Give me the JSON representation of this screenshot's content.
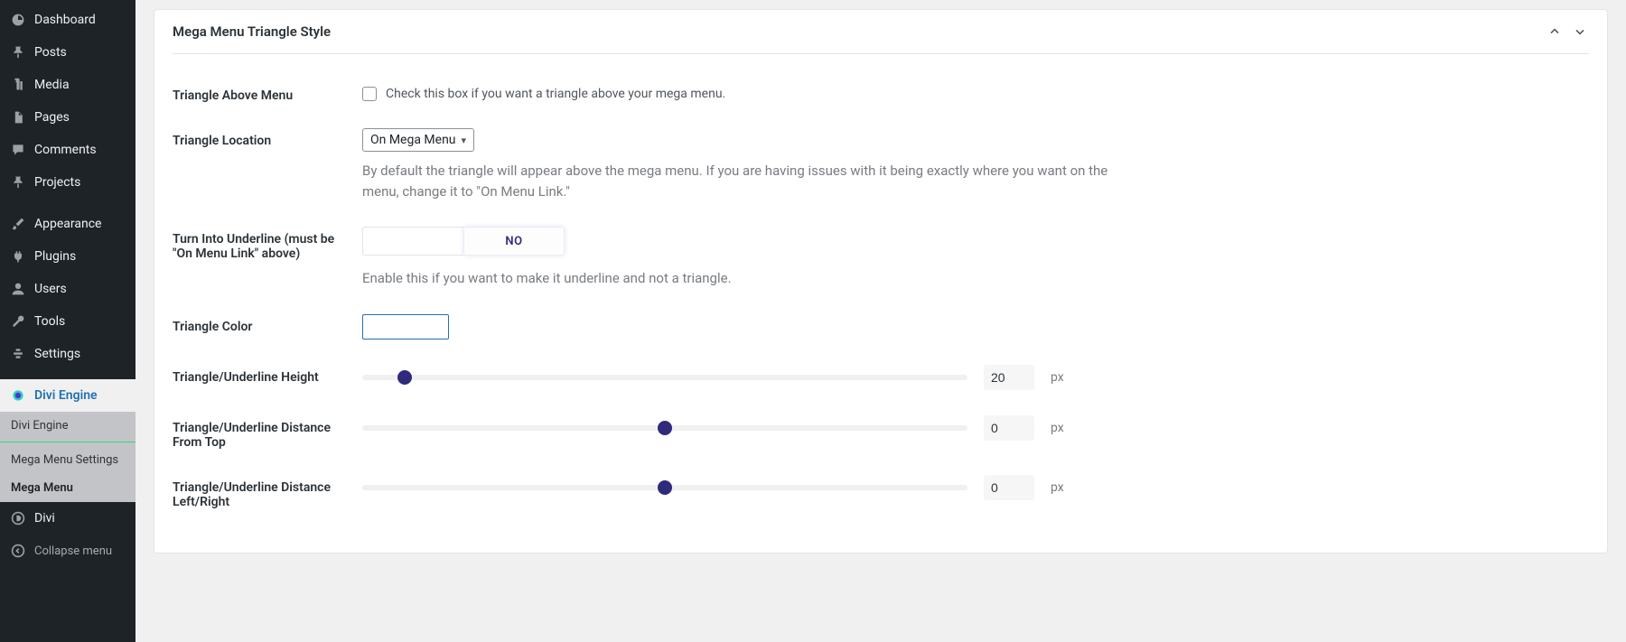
{
  "sidebar": {
    "items": [
      {
        "label": "Dashboard",
        "icon": "dashboard"
      },
      {
        "label": "Posts",
        "icon": "pin"
      },
      {
        "label": "Media",
        "icon": "media"
      },
      {
        "label": "Pages",
        "icon": "pages"
      },
      {
        "label": "Comments",
        "icon": "comment"
      },
      {
        "label": "Projects",
        "icon": "pin"
      }
    ],
    "items2": [
      {
        "label": "Appearance",
        "icon": "brush"
      },
      {
        "label": "Plugins",
        "icon": "plug"
      },
      {
        "label": "Users",
        "icon": "user"
      },
      {
        "label": "Tools",
        "icon": "wrench"
      },
      {
        "label": "Settings",
        "icon": "settings"
      }
    ],
    "current": {
      "label": "Divi Engine"
    },
    "submenu": [
      {
        "label": "Divi Engine"
      },
      {
        "label": "Mega Menu Settings"
      },
      {
        "label": "Mega Menu"
      }
    ],
    "divi": {
      "label": "Divi"
    },
    "collapse": {
      "label": "Collapse menu"
    }
  },
  "panel": {
    "title": "Mega Menu Triangle Style",
    "fields": {
      "triangle_above": {
        "label": "Triangle Above Menu",
        "check_label": "Check this box if you want a triangle above your mega menu."
      },
      "triangle_location": {
        "label": "Triangle Location",
        "value": "On Mega Menu",
        "help": "By default the triangle will appear above the mega menu. If you are having issues with it being exactly where you want on the menu, change it to \"On Menu Link.\""
      },
      "turn_into_underline": {
        "label": "Turn Into Underline (must be \"On Menu Link\" above)",
        "value": "NO",
        "help": "Enable this if you want to make it underline and not a triangle."
      },
      "triangle_color": {
        "label": "Triangle Color",
        "value": "#ffffff"
      },
      "height": {
        "label": "Triangle/Underline Height",
        "value": "20",
        "unit": "px",
        "thumb_pct": 7
      },
      "distance_top": {
        "label": "Triangle/Underline Distance From Top",
        "value": "0",
        "unit": "px",
        "thumb_pct": 50
      },
      "distance_lr": {
        "label": "Triangle/Underline Distance Left/Right",
        "value": "0",
        "unit": "px",
        "thumb_pct": 50
      }
    }
  }
}
